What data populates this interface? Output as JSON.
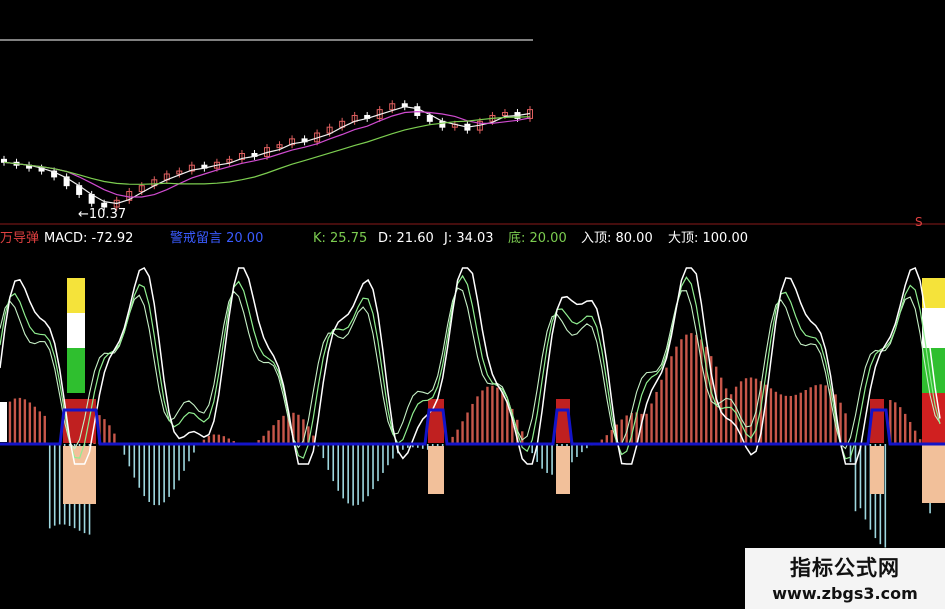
{
  "chart_data": {
    "type": "line",
    "price_panel": {
      "low_marker_label": "←10.37",
      "right_marker": "S",
      "colors": {
        "up": "#e06060",
        "down": "#ffffff",
        "ma_short": "#f0f0f0",
        "ma_mid": "#d04bd0",
        "ma_long": "#7ccd50"
      },
      "price_low": 10.37,
      "candles": [
        11.9,
        11.8,
        11.7,
        11.6,
        11.4,
        11.1,
        10.8,
        10.5,
        10.37,
        10.6,
        10.9,
        11.1,
        11.3,
        11.5,
        11.6,
        11.8,
        11.7,
        11.9,
        12.0,
        12.2,
        12.1,
        12.4,
        12.5,
        12.7,
        12.6,
        12.9,
        13.1,
        13.3,
        13.5,
        13.4,
        13.7,
        13.9,
        13.8,
        13.5,
        13.3,
        13.1,
        13.2,
        13.0,
        13.3,
        13.5,
        13.6,
        13.4,
        13.7
      ]
    },
    "indicator_panel": {
      "labels": [
        {
          "key": "name",
          "text": "万导弹",
          "color": "#e04040"
        },
        {
          "key": "macd",
          "text": "MACD: -72.92",
          "color": "#ffffff"
        },
        {
          "key": "warn",
          "text": "警戒留言  20.00",
          "color": "#3a5bff"
        },
        {
          "key": "k",
          "text": "K: 25.75",
          "color": "#7ccd50"
        },
        {
          "key": "d",
          "text": "D: 21.60",
          "color": "#ffffff"
        },
        {
          "key": "j",
          "text": "J: 34.03",
          "color": "#ffffff"
        },
        {
          "key": "bottom",
          "text": "底: 20.00",
          "color": "#7ccd50"
        },
        {
          "key": "entry",
          "text": "入顶: 80.00",
          "color": "#ffffff"
        },
        {
          "key": "top",
          "text": "大顶: 100.00",
          "color": "#ffffff"
        }
      ],
      "values": {
        "MACD": -72.92,
        "警戒留言": 20.0,
        "K": 25.75,
        "D": 21.6,
        "J": 34.03,
        "底": 20.0,
        "入顶": 80.0,
        "大顶": 100.0
      },
      "colors": {
        "macd_pos": "#c8574a",
        "macd_neg": "#9fd8e0",
        "j_line": "#ffffff",
        "k_line": "#90ee90",
        "d_line": "#c6f0c6",
        "baseline": "#1414c8",
        "zone": "#f2c09a"
      }
    },
    "watermark": {
      "line1": "指标公式网",
      "line2": "www.zbgs3.com"
    }
  }
}
